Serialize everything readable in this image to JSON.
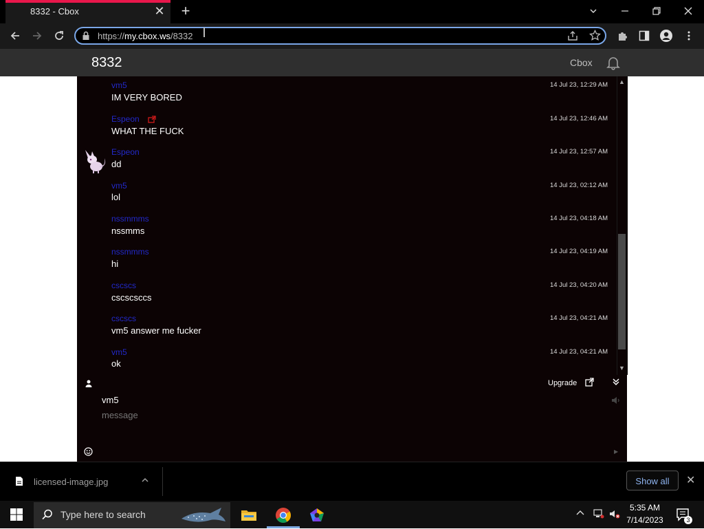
{
  "browser": {
    "tab_title": "8332 - Cbox",
    "tab_close": "✕",
    "new_tab": "+",
    "url_scheme": "https://",
    "url_host": "my.cbox.ws",
    "url_path": "/8332"
  },
  "page": {
    "title": "8332",
    "cbox_link": "Cbox"
  },
  "chat": {
    "messages": [
      {
        "name": "vm5",
        "text": "IM VERY BORED",
        "time": "14 Jul 23, 12:29 AM"
      },
      {
        "name": "Espeon",
        "text": "WHAT THE FUCK",
        "time": "14 Jul 23, 12:46 AM"
      },
      {
        "name": "Espeon",
        "text": "dd",
        "time": "14 Jul 23, 12:57 AM"
      },
      {
        "name": "vm5",
        "text": "lol",
        "time": "14 Jul 23, 02:12 AM"
      },
      {
        "name": "nssmmms",
        "text": "nssmms",
        "time": "14 Jul 23, 04:18 AM"
      },
      {
        "name": "nssmmms",
        "text": "hi",
        "time": "14 Jul 23, 04:19 AM"
      },
      {
        "name": "cscscs",
        "text": "cscscsccs",
        "time": "14 Jul 23, 04:20 AM"
      },
      {
        "name": "cscscs",
        "text": "vm5 answer me fucker",
        "time": "14 Jul 23, 04:21 AM"
      },
      {
        "name": "vm5",
        "text": "ok",
        "time": "14 Jul 23, 04:21 AM"
      }
    ],
    "upgrade_label": "Upgrade",
    "name_value": "vm5",
    "message_placeholder": "message"
  },
  "downloads": {
    "file_name": "licensed-image.jpg",
    "show_all": "Show all",
    "close": "✕"
  },
  "taskbar": {
    "search_placeholder": "Type here to search",
    "time": "5:35 AM",
    "date": "7/14/2023",
    "notification_count": "3"
  },
  "colors": {
    "chat_bg": "#0c0304",
    "username": "#2229c9",
    "tab_accent": "#e8174b",
    "omnibox_border": "#7aa7e8"
  }
}
